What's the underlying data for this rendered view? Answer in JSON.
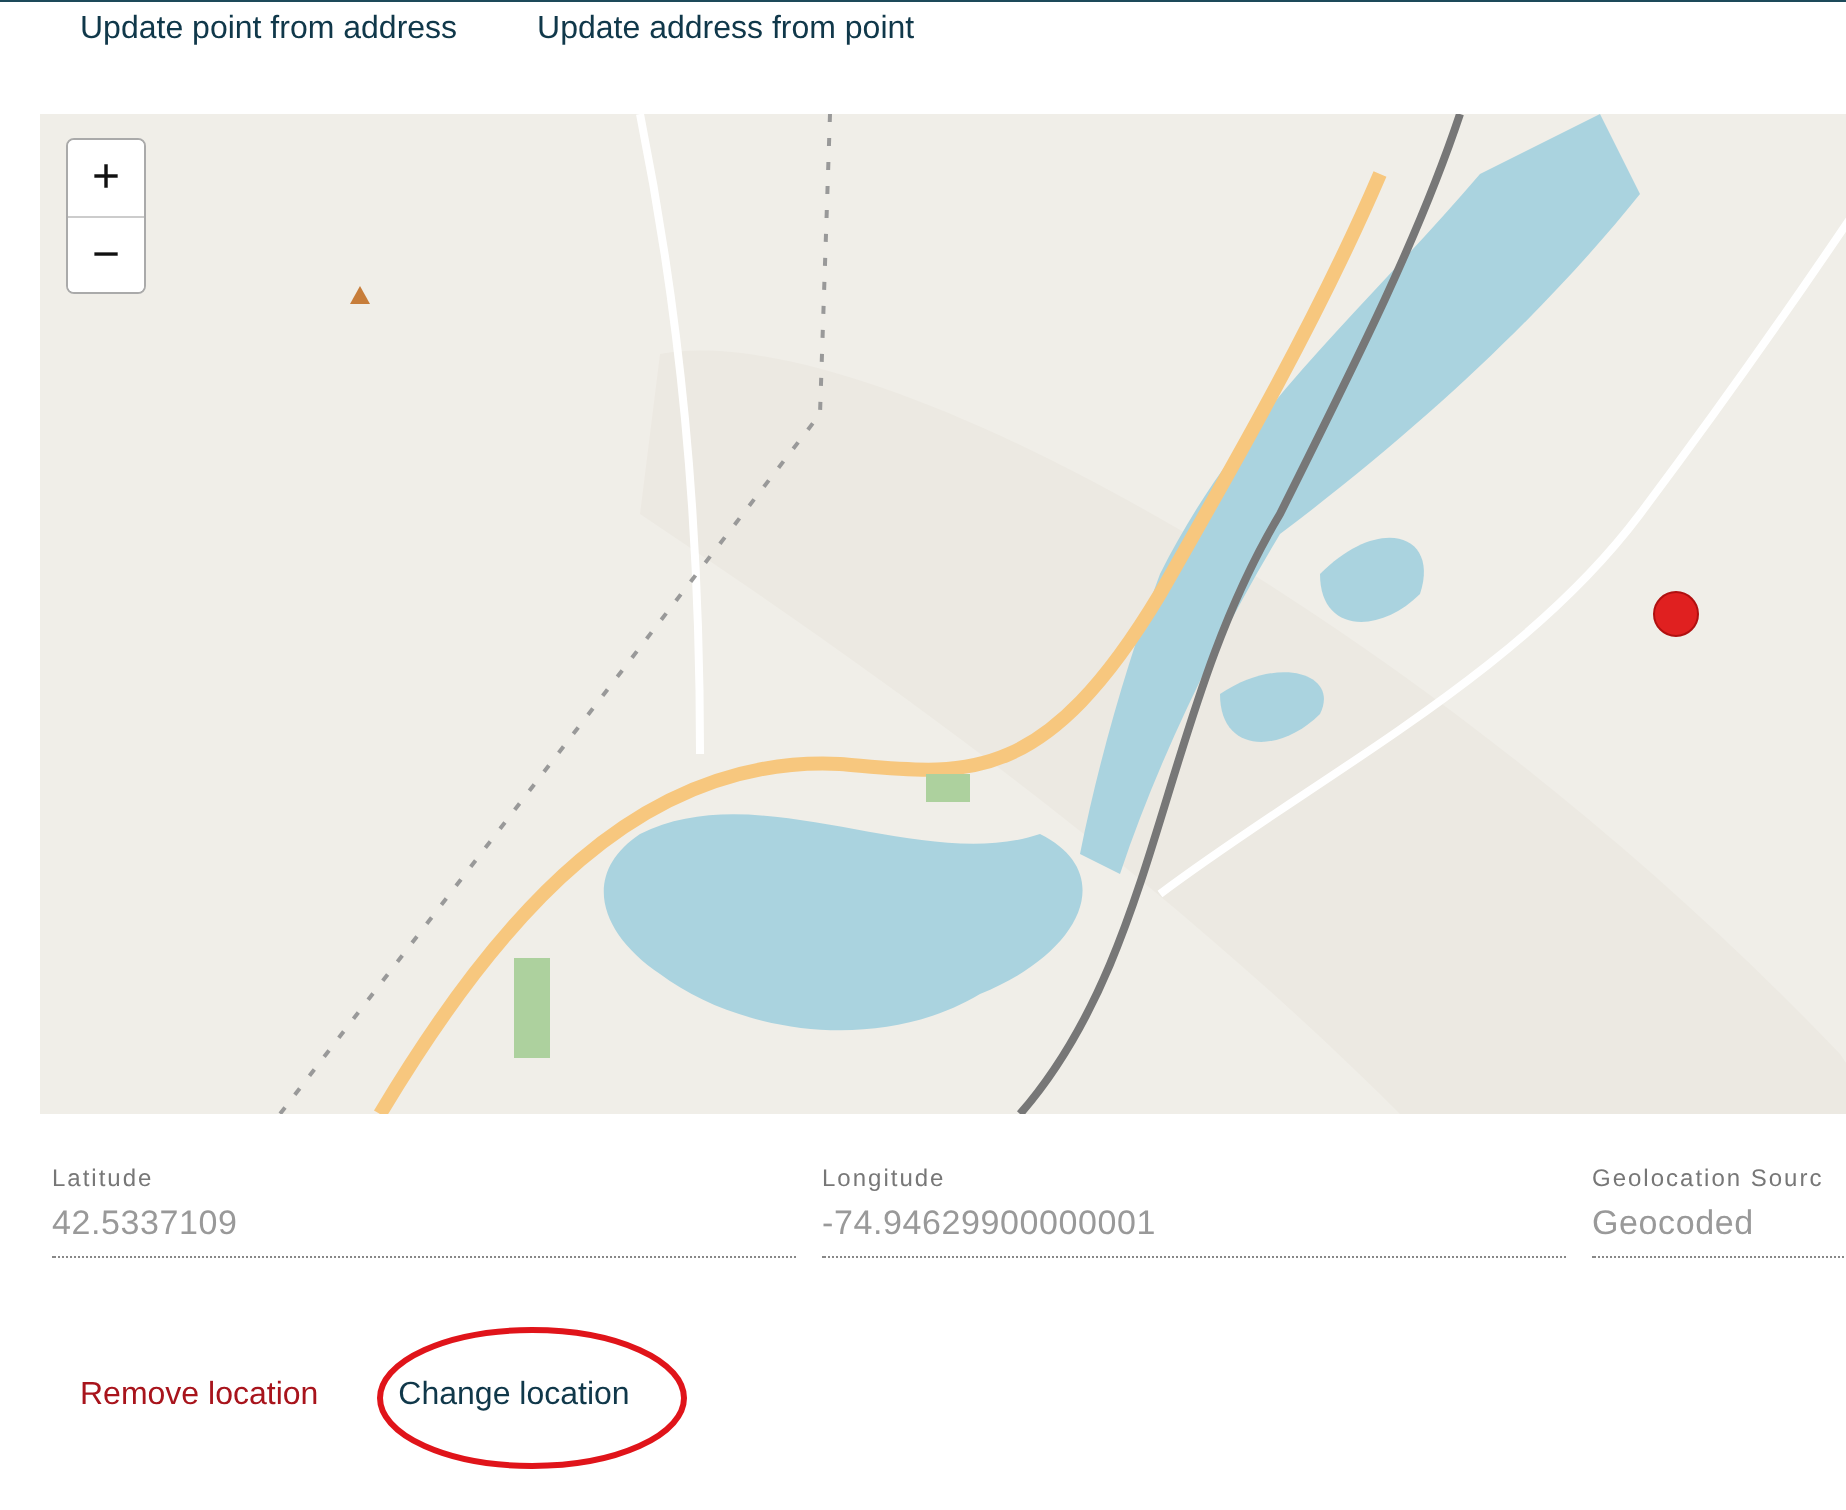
{
  "top_actions": [
    {
      "label": "Update point from address"
    },
    {
      "label": "Update address from point"
    }
  ],
  "map": {
    "kind": "picture",
    "zoom_controls": [
      {
        "label": "+"
      },
      {
        "label": "−"
      }
    ],
    "marker": true
  },
  "fields": [
    {
      "label": "Latitude",
      "value": "42.5337109",
      "disabled": true
    },
    {
      "label": "Longitude",
      "value": "-74.94629900000001",
      "disabled": true
    },
    {
      "label": "Geolocation Sourc",
      "value": "Geocoded",
      "disabled": true
    }
  ],
  "actions": [
    {
      "label": "Remove location",
      "kind": "danger",
      "highlighted": false
    },
    {
      "label": "Change location",
      "kind": "primary",
      "highlighted": true
    }
  ]
}
